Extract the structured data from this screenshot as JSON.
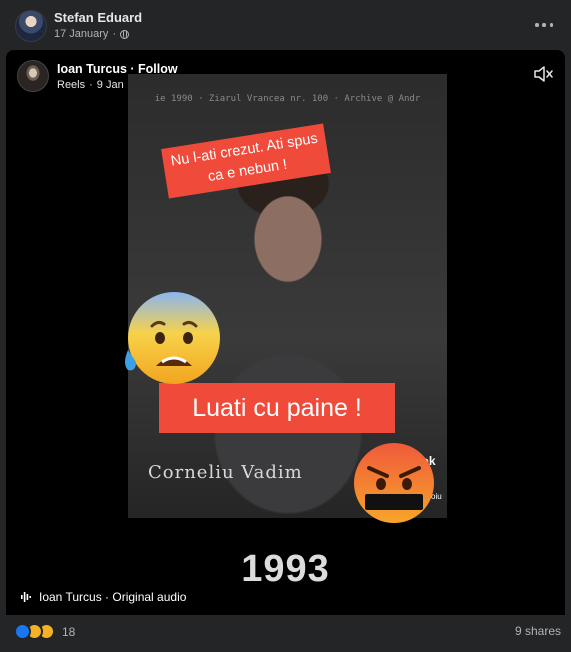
{
  "post": {
    "author": "Stefan Eduard",
    "date": "17 January",
    "more_icon": "more-horizontal-icon"
  },
  "reel": {
    "author_follow": "Ioan Turcus · Follow",
    "source": "Reels",
    "date": "9 Jan",
    "top_caption": "ie 1990 · Ziarul Vrancea nr. 100 · Archive @ Andr",
    "sticker_top": "Nu l-ati crezut. Ati spus ca e nebun !",
    "sticker_main": "Luati cu paine !",
    "name_caption": "Corneliu Vadim",
    "tiktok_word": "TikTok",
    "tiktok_handle": "@ emildobroiu",
    "symbols": "!#%",
    "year": "1993",
    "audio_label": "Ioan Turcus · Original audio",
    "mute_icon": "speaker-muted-icon"
  },
  "footer": {
    "reaction_count": "18",
    "shares": "9 shares"
  },
  "colors": {
    "background": "#242526",
    "sticker_red": "#f04a3a",
    "like_blue": "#1877f2"
  }
}
